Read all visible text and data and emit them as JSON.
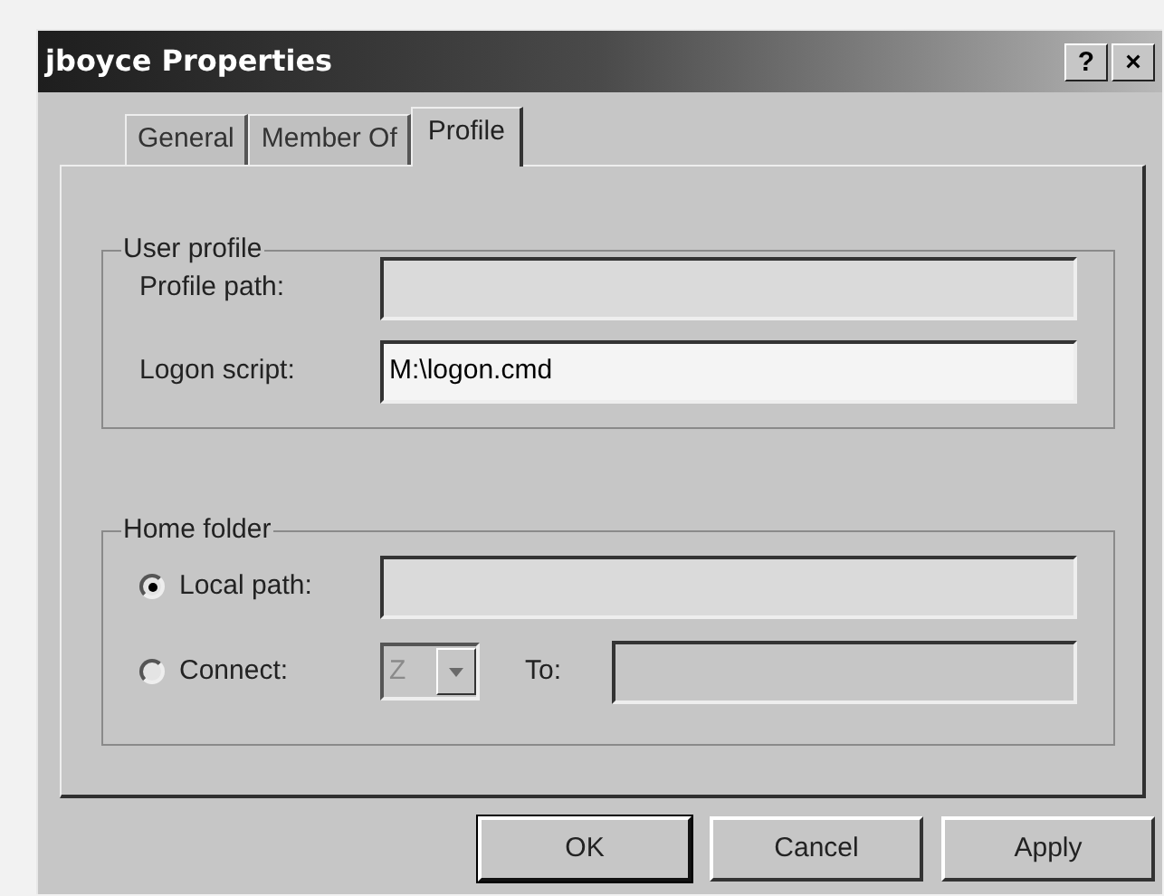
{
  "window": {
    "title": "jboyce Properties",
    "title_buttons": [
      "?",
      "×"
    ]
  },
  "tabs": [
    {
      "label": "General",
      "selected": false
    },
    {
      "label": "Member Of",
      "selected": false
    },
    {
      "label": "Profile",
      "selected": true
    }
  ],
  "user_profile": {
    "title": "User profile",
    "fields": [
      {
        "label": "Profile path:",
        "disabled": false
      },
      {
        "label": "Logon script:",
        "value": "M:\\logon.cmd",
        "disabled": false
      }
    ]
  },
  "home_folder": {
    "title": "Home folder",
    "options": [
      {
        "label": "Local path:",
        "selected": true
      },
      {
        "label": "Connect:",
        "selected": false
      }
    ],
    "drive": {
      "value": "Z",
      "disabled": true
    },
    "to_label": "To:",
    "to_field": {
      "disabled": true
    }
  },
  "buttons": [
    "OK",
    "Cancel",
    "Apply"
  ]
}
